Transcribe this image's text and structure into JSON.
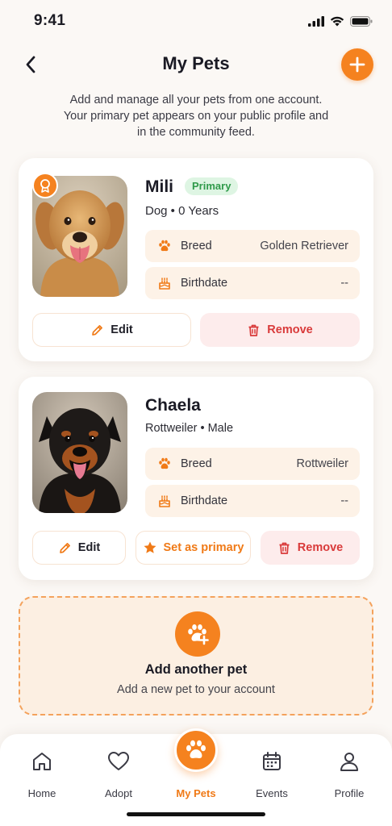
{
  "status": {
    "time": "9:41"
  },
  "header": {
    "title": "My Pets"
  },
  "intro": {
    "line1": "Add and manage all your pets from one account.",
    "line2": "Your primary pet appears on your public profile and",
    "line3": "in the community feed."
  },
  "pets": [
    {
      "name": "Mili",
      "badge": "Primary",
      "subtitle": "Dog • 0 Years",
      "breed_label": "Breed",
      "breed_value": "Golden Retriever",
      "birth_label": "Birthdate",
      "birth_value": "--",
      "edit_label": "Edit",
      "remove_label": "Remove"
    },
    {
      "name": "Chaela",
      "subtitle": "Rottweiler • Male",
      "breed_label": "Breed",
      "breed_value": "Rottweiler",
      "birth_label": "Birthdate",
      "birth_value": "--",
      "edit_label": "Edit",
      "set_primary_label": "Set as primary",
      "remove_label": "Remove"
    }
  ],
  "add_pet": {
    "title": "Add another pet",
    "subtitle": "Add a new pet to your account"
  },
  "tabs": [
    {
      "label": "Home",
      "icon": "home-icon"
    },
    {
      "label": "Adopt",
      "icon": "heart-icon"
    },
    {
      "label": "My Pets",
      "icon": "paw-icon",
      "active": true
    },
    {
      "label": "Events",
      "icon": "calendar-icon"
    },
    {
      "label": "Profile",
      "icon": "user-icon"
    }
  ],
  "colors": {
    "accent": "#f5821f",
    "danger": "#d93a3a",
    "primary_badge_bg": "#def5e3",
    "primary_badge_text": "#2f9a4a",
    "info_row_bg": "#fdf2e7"
  }
}
